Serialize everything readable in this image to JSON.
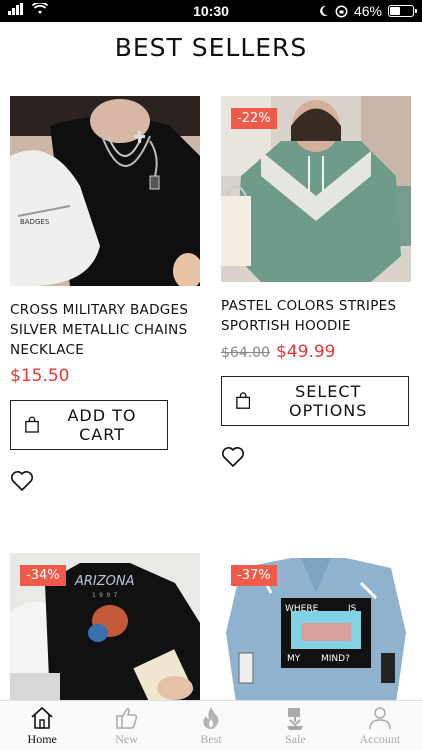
{
  "status_bar": {
    "time": "10:30",
    "battery": "46%",
    "battery_level": 0.46
  },
  "page": {
    "title": "BEST SELLERS"
  },
  "products": [
    {
      "name": "CROSS MILITARY BADGES SILVER METALLIC CHAINS NECKLACE",
      "price": "$15.50",
      "button": "ADD TO CART"
    },
    {
      "badge": "-22%",
      "name": "PASTEL COLORS STRIPES SPORTISH HOODIE",
      "old_price": "$64.00",
      "price": "$49.99",
      "button": "SELECT OPTIONS"
    },
    {
      "badge": "-34%"
    },
    {
      "badge": "-37%"
    }
  ],
  "tabs": [
    {
      "label": "Home",
      "icon": "home-icon",
      "active": true
    },
    {
      "label": "New",
      "icon": "thumbs-up-icon"
    },
    {
      "label": "Best",
      "icon": "flame-icon"
    },
    {
      "label": "Sale",
      "icon": "sale-tag-icon"
    },
    {
      "label": "Account",
      "icon": "user-icon"
    }
  ],
  "colors": {
    "accent": "#e53935",
    "badge": "#f05a4a"
  }
}
